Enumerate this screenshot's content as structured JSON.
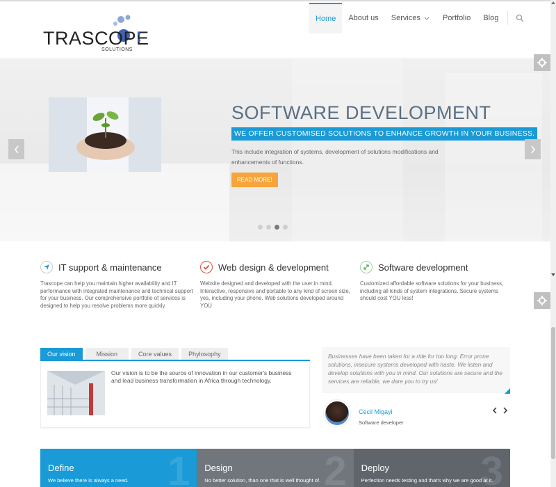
{
  "header": {
    "logo_text": "TRASCOPE",
    "logo_sub": "SOLUTIONS",
    "nav": [
      {
        "label": "Home"
      },
      {
        "label": "About us"
      },
      {
        "label": "Services"
      },
      {
        "label": "Portfolio"
      },
      {
        "label": "Blog"
      }
    ]
  },
  "slider": {
    "title": "SOFTWARE DEVELOPMENT",
    "subtitle": "WE OFFER CUSTOMISED SOLUTIONS TO ENHANCE GROWTH IN YOUR BUSINESS.",
    "description": "This include integration of systems, development of solutions modifications and enhancements of functions.",
    "button": "READ MORE!",
    "active_dot": 3,
    "dot_count": 4
  },
  "features": [
    {
      "title": "IT support & maintenance",
      "text": "Trascope can help you maintain higher availability and IT performance with integrated maintenance and technical support for your business. Our comprehensive portfolio of services is designed to help you resolve problems more quickly.",
      "icon": "paper-plane-icon",
      "color": "#1a9ad6"
    },
    {
      "title": "Web design & development",
      "text": "Website designed and developed with the user in mind. Interactive, responsive and portable to any kind of screen size, yes, including your phone. Web solutions developed around YOU",
      "icon": "checkmark-icon",
      "color": "#e04b3a"
    },
    {
      "title": "Software development",
      "text": "Customized affordable software solutions for your business, including all kinds of system integrations. Secure systems should cost YOU less!",
      "icon": "arrows-icon",
      "color": "#4cae4c"
    }
  ],
  "tabs": {
    "items": [
      {
        "label": "Our vision"
      },
      {
        "label": "Mission"
      },
      {
        "label": "Core values"
      },
      {
        "label": "Phylosophy"
      }
    ],
    "content": "Our vision is to be the source of innovation in our customer's business and lead business transformation in Africa through technology."
  },
  "testimonial": {
    "quote": "Businesses have been taken for a ride for too long. Error prone solutions, insecure systems developed with haste. We listen and develop solutions with you in mind. Our solutions are secure and the services are reliable, we dare you to try us!",
    "name": "Cecil Migayi",
    "role": "Software developer"
  },
  "process": [
    {
      "title": "Define",
      "text": "We believe there is always a need.",
      "num": "1"
    },
    {
      "title": "Design",
      "text": "No better solution, than one that is well thought of.",
      "num": "2"
    },
    {
      "title": "Deploy",
      "text": "Perfection needs testing and that's why we are good at it.",
      "num": "3"
    }
  ],
  "colors": {
    "accent": "#1a9ad6",
    "button": "#f7a53a"
  }
}
